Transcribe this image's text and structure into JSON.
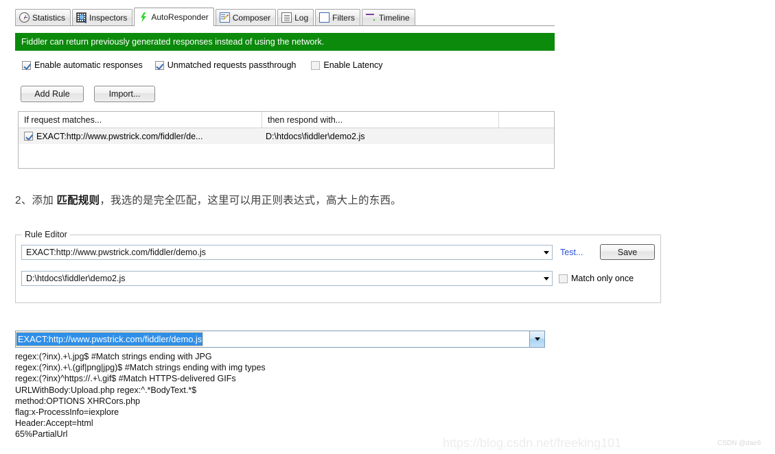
{
  "tabs": [
    {
      "label": "Statistics",
      "icon": "stopwatch-icon",
      "icon_class": "ic-stat",
      "active": false
    },
    {
      "label": "Inspectors",
      "icon": "magnifier-grid-icon",
      "icon_class": "ic-insp",
      "active": false
    },
    {
      "label": "AutoResponder",
      "icon": "lightning-bolt-icon",
      "icon_class": "ic-auto",
      "active": true
    },
    {
      "label": "Composer",
      "icon": "notepad-pencil-icon",
      "icon_class": "ic-comp",
      "active": false
    },
    {
      "label": "Log",
      "icon": "document-lines-icon",
      "icon_class": "ic-log",
      "active": false
    },
    {
      "label": "Filters",
      "icon": "empty-square-icon",
      "icon_class": "ic-filt",
      "active": false
    },
    {
      "label": "Timeline",
      "icon": "timeline-bars-icon",
      "icon_class": "ic-time",
      "active": false
    }
  ],
  "banner": {
    "text": "Fiddler can return previously generated responses instead of using the network.",
    "background": "#0c8a0c",
    "color": "#ffffff"
  },
  "options": [
    {
      "label": "Enable automatic responses",
      "checked": true,
      "enabled": true
    },
    {
      "label": "Unmatched requests passthrough",
      "checked": true,
      "enabled": true
    },
    {
      "label": "Enable Latency",
      "checked": false,
      "enabled": false
    }
  ],
  "toolbar": {
    "add_rule_label": "Add Rule",
    "import_label": "Import..."
  },
  "rules_table": {
    "headers": [
      "If request matches...",
      "then respond with...",
      ""
    ],
    "rows": [
      {
        "checked": true,
        "match": "EXACT:http://www.pwstrick.com/fiddler/de...",
        "respond": "D:\\htdocs\\fiddler\\demo2.js",
        "extra": ""
      }
    ]
  },
  "caption": {
    "prefix": "2、添加 ",
    "bold": "匹配规则",
    "suffix": "，我选的是完全匹配，这里可以用正则表达式，高大上的东西。"
  },
  "rule_editor": {
    "legend": "Rule Editor",
    "match_value": "EXACT:http://www.pwstrick.com/fiddler/demo.js",
    "respond_value": "D:\\htdocs\\fiddler\\demo2.js",
    "test_label": "Test...",
    "save_label": "Save",
    "match_once_label": "Match only once",
    "match_once_checked": false,
    "link_color": "#2b4fd6"
  },
  "dropdown": {
    "selected": "EXACT:http://www.pwstrick.com/fiddler/demo.js",
    "selection_background": "#2f8fe8",
    "items": [
      "regex:(?inx).+\\.jpg$ #Match strings ending with JPG",
      "regex:(?inx).+\\.(gif|png|jpg)$ #Match strings ending with img types",
      "regex:(?inx)^https://.+\\.gif$ #Match HTTPS-delivered GIFs",
      "URLWithBody:Upload.php regex:^.*BodyText.*$",
      "method:OPTIONS XHRCors.php",
      "flag:x-ProcessInfo=iexplore",
      "Header:Accept=html",
      "65%PartialUrl"
    ]
  },
  "watermark": {
    "url": "https://blog.csdn.net/freeking101",
    "handle": "CSDN @dair6"
  }
}
